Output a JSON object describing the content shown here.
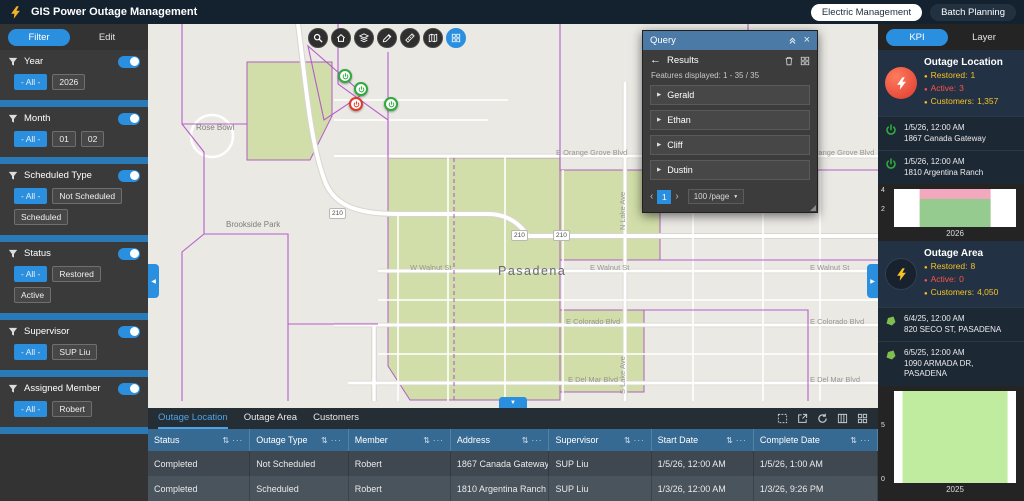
{
  "header": {
    "app_title": "GIS Power Outage Management",
    "electric_btn": "Electric Management",
    "batch_btn": "Batch Planning"
  },
  "icons": {
    "sort": "⇅",
    "menu_dots": "···",
    "back": "←",
    "close": "×",
    "caret_right": "▶",
    "caret_down": "▼",
    "chevron_left": "◀",
    "chevron_right": "▶",
    "prev": "‹",
    "next": "›",
    "bullet": "●"
  },
  "colors": {
    "accent_blue": "#2b8fe0",
    "restored_green": "#2faa3e",
    "active_red": "#ff5347",
    "kpi_yellow": "#f7c325",
    "boundary_purple": "#b14fc9",
    "outage_area_green": "#ccdc9f",
    "table_header_blue": "#376a92"
  },
  "left_panel": {
    "filter_tab": "Filter",
    "edit_tab": "Edit",
    "groups": [
      {
        "label": "Year",
        "enabled": true,
        "chips": [
          {
            "label": "- All -"
          },
          {
            "label": "2026"
          }
        ]
      },
      {
        "label": "Month",
        "enabled": true,
        "chips": [
          {
            "label": "- All -"
          },
          {
            "label": "01"
          },
          {
            "label": "02"
          }
        ]
      },
      {
        "label": "Scheduled Type",
        "enabled": true,
        "chips": [
          {
            "label": "- All -"
          },
          {
            "label": "Not Scheduled"
          },
          {
            "label": "Scheduled"
          }
        ]
      },
      {
        "label": "Status",
        "enabled": true,
        "chips": [
          {
            "label": "- All -"
          },
          {
            "label": "Restored"
          },
          {
            "label": "Active"
          }
        ]
      },
      {
        "label": "Supervisor",
        "enabled": true,
        "chips": [
          {
            "label": "- All -"
          },
          {
            "label": "SUP Liu"
          }
        ]
      },
      {
        "label": "Assigned Member",
        "enabled": true,
        "chips": [
          {
            "label": "- All -"
          },
          {
            "label": "Robert"
          }
        ]
      }
    ]
  },
  "map": {
    "toolbar": [
      "search",
      "home",
      "layers",
      "draw",
      "measure",
      "basemap",
      "query"
    ],
    "place_labels": [
      {
        "text": "Rose Bowl"
      },
      {
        "text": "Brookside Park"
      },
      {
        "text": "Pasadena"
      }
    ],
    "street_labels": [
      {
        "text": "E Orange Grove Blvd"
      },
      {
        "text": "E Orange Grove Blvd"
      },
      {
        "text": "W Walnut St"
      },
      {
        "text": "E Walnut St"
      },
      {
        "text": "E Walnut St"
      },
      {
        "text": "E Colorado Blvd"
      },
      {
        "text": "E Colorado Blvd"
      },
      {
        "text": "E Del Mar Blvd"
      },
      {
        "text": "E Del Mar Blvd"
      },
      {
        "text": "N Lake Ave"
      },
      {
        "text": "S Lake Ave"
      }
    ],
    "highway_shields": [
      "210",
      "210",
      "210"
    ],
    "markers": [
      {
        "status": "restored"
      },
      {
        "status": "restored"
      },
      {
        "status": "restored"
      },
      {
        "status": "active"
      }
    ]
  },
  "query_panel": {
    "title": "Query",
    "results_label": "Results",
    "features_line": "Features displayed: 1 - 35 / 35",
    "groups": [
      {
        "name": "Gerald"
      },
      {
        "name": "Ethan"
      },
      {
        "name": "Cliff"
      },
      {
        "name": "Dustin"
      }
    ],
    "pagination": {
      "page": "1",
      "page_size": "100 /page"
    }
  },
  "right_panel": {
    "kpi_tab": "KPI",
    "layer_tab": "Layer",
    "cards": [
      {
        "title": "Outage Location",
        "stats": [
          {
            "label": "Restored:",
            "value": "1",
            "color": "#f7c325"
          },
          {
            "label": "Active:",
            "value": "3",
            "color": "#ff5347"
          },
          {
            "label": "Customers:",
            "value": "1,357",
            "color": "#f7c325"
          }
        ],
        "items": [
          {
            "datetime": "1/5/26, 12:00 AM",
            "address": "1867 Canada Gateway"
          },
          {
            "datetime": "1/5/26, 12:00 AM",
            "address": "1810 Argentina Ranch"
          }
        ],
        "chart": {
          "type": "bar",
          "ymax": 4,
          "yticks": [
            "4",
            "2"
          ],
          "xlabel": "2026",
          "segments": [
            {
              "color": "#f2a8bd",
              "value": 1
            },
            {
              "color": "#96cb90",
              "value": 3
            }
          ]
        }
      },
      {
        "title": "Outage Area",
        "stats": [
          {
            "label": "Restored:",
            "value": "8",
            "color": "#f7c325"
          },
          {
            "label": "Active:",
            "value": "0",
            "color": "#ff5347"
          },
          {
            "label": "Customers:",
            "value": "4,050",
            "color": "#f7c325"
          }
        ],
        "items": [
          {
            "datetime": "6/4/25, 12:00 AM",
            "address": "820 SECO ST, PASADENA"
          },
          {
            "datetime": "6/5/25, 12:00 AM",
            "address": "1090 ARMADA DR, PASADENA"
          }
        ],
        "chart": {
          "type": "bar",
          "ymax": 8,
          "yticks": [
            "5",
            "0"
          ],
          "xlabel": "2025",
          "segments": [
            {
              "color": "#bfec9f",
              "value": 8
            }
          ]
        }
      }
    ]
  },
  "bottom_panel": {
    "tabs": [
      "Outage Location",
      "Outage Area",
      "Customers"
    ],
    "toolbar_icons": [
      "select",
      "export",
      "refresh",
      "columns",
      "grid"
    ],
    "columns": [
      "Status",
      "Outage Type",
      "Member",
      "Address",
      "Supervisor",
      "Start Date",
      "Complete Date"
    ],
    "rows": [
      [
        "Completed",
        "Not Scheduled",
        "Robert",
        "1867 Canada Gateway",
        "SUP Liu",
        "1/5/26, 12:00 AM",
        "1/5/26, 1:00 AM"
      ],
      [
        "Completed",
        "Scheduled",
        "Robert",
        "1810 Argentina Ranch",
        "SUP Liu",
        "1/3/26, 12:00 AM",
        "1/3/26, 9:26 PM"
      ]
    ]
  }
}
